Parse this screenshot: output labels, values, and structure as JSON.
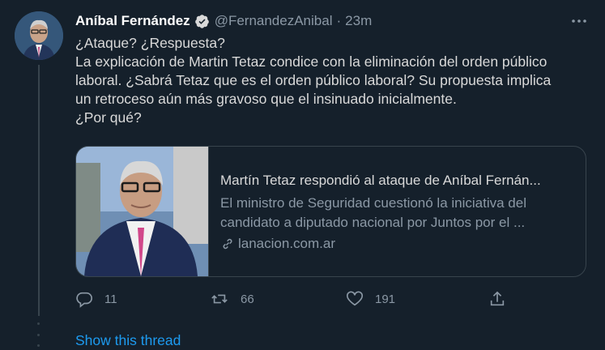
{
  "tweet": {
    "author_name": "Aníbal Fernández",
    "handle": "@FernandezAnibal",
    "separator": "·",
    "time": "23m",
    "text_lines": [
      "¿Ataque? ¿Respuesta?",
      "La explicación de Martin Tetaz condice con la eliminación del orden público",
      "laboral. ¿Sabrá Tetaz que es el orden público laboral? Su propuesta implica",
      "un retroceso aún más gravoso que el insinuado inicialmente.",
      "¿Por qué?"
    ]
  },
  "card": {
    "title": "Martín Tetaz respondió al ataque de Aníbal Fernán...",
    "desc_lines": [
      "El ministro de Seguridad cuestionó la iniciativa del",
      "candidato a diputado nacional por Juntos por el ..."
    ],
    "link": "lanacion.com.ar"
  },
  "actions": {
    "replies": "11",
    "retweets": "66",
    "likes": "191"
  },
  "show_thread": "Show this thread",
  "icons": [
    "verified-badge-icon",
    "more-icon",
    "reply-icon",
    "retweet-icon",
    "like-icon",
    "share-icon",
    "link-icon"
  ],
  "colors": {
    "background": "#15202b",
    "accent": "#1d9bf0",
    "muted": "#8b98a5"
  }
}
